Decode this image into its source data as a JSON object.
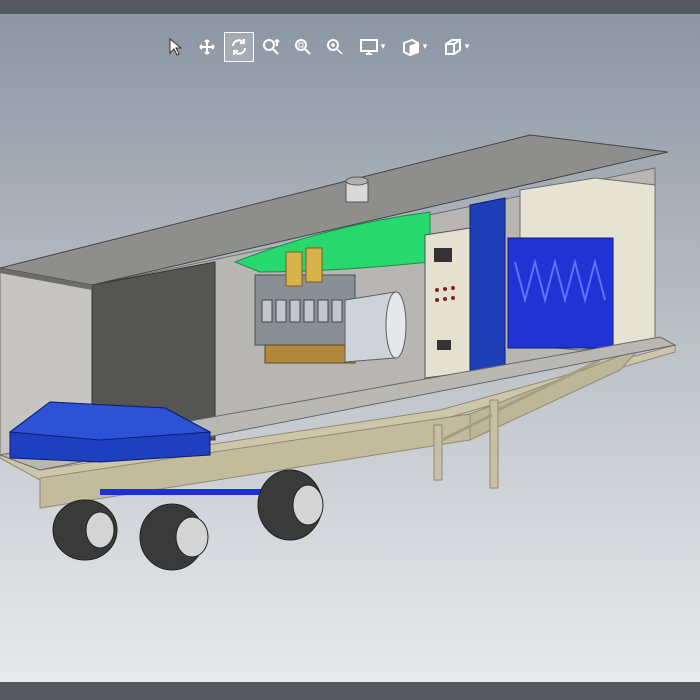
{
  "window": {
    "title": ""
  },
  "toolbar": {
    "tools": [
      {
        "name": "select",
        "icon": "cursor-arrow-icon",
        "active": false
      },
      {
        "name": "pan",
        "icon": "move-arrows-icon",
        "active": false
      },
      {
        "name": "rotate",
        "icon": "rotate-icon",
        "active": true
      },
      {
        "name": "zoom",
        "icon": "zoom-icon",
        "active": false
      },
      {
        "name": "zoom-window",
        "icon": "zoom-window-icon",
        "active": false
      },
      {
        "name": "zoom-fit",
        "icon": "zoom-fit-icon",
        "active": false
      },
      {
        "name": "display-mode",
        "icon": "monitor-icon",
        "has_dropdown": true
      },
      {
        "name": "section-view",
        "icon": "section-view-icon",
        "has_dropdown": true
      },
      {
        "name": "standard-views",
        "icon": "cube-icon",
        "has_dropdown": true
      }
    ]
  },
  "model": {
    "description_icon": "trailer-generator-model",
    "colors": {
      "roof": "#8a8a8a",
      "walls": "#c9c9c7",
      "enclosure_blue": "#1f3fb8",
      "radiator_green": "#23d36a",
      "transformer_blue": "#2336d8",
      "chassis": "#c8c0a4",
      "tire": "#3a3a3a"
    }
  }
}
